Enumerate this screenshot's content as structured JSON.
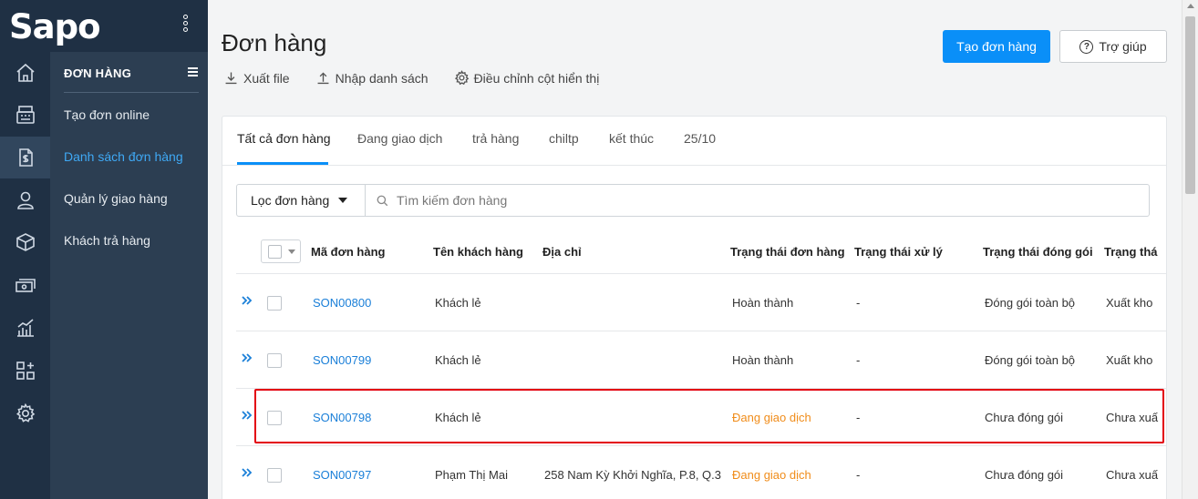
{
  "brand": {
    "logo_text": "Sapo"
  },
  "rail": {
    "items": [
      {
        "icon": "home-icon"
      },
      {
        "icon": "pos-register-icon"
      },
      {
        "icon": "order-document-icon",
        "active": true
      },
      {
        "icon": "user-icon"
      },
      {
        "icon": "box-icon"
      },
      {
        "icon": "cash-icon"
      },
      {
        "icon": "chart-icon"
      },
      {
        "icon": "apps-icon"
      },
      {
        "icon": "settings-icon"
      }
    ]
  },
  "submenu": {
    "title": "ĐƠN HÀNG",
    "items": [
      {
        "label": "Tạo đơn online"
      },
      {
        "label": "Danh sách đơn hàng",
        "active": true
      },
      {
        "label": "Quản lý giao hàng"
      },
      {
        "label": "Khách trả hàng"
      }
    ]
  },
  "header": {
    "title": "Đơn hàng",
    "create_label": "Tạo đơn hàng",
    "help_label": "Trợ giúp",
    "actions": {
      "export": "Xuất file",
      "import": "Nhập danh sách",
      "columns": "Điều chỉnh cột hiển thị"
    }
  },
  "tabs": [
    {
      "label": "Tất cả đơn hàng",
      "active": true
    },
    {
      "label": "Đang giao dịch"
    },
    {
      "label": "trả hàng"
    },
    {
      "label": "chiltp"
    },
    {
      "label": "kết thúc"
    },
    {
      "label": "25/10"
    }
  ],
  "filter": {
    "button_label": "Lọc đơn hàng",
    "search_placeholder": "Tìm kiếm đơn hàng"
  },
  "table": {
    "columns": [
      "Mã đơn hàng",
      "Tên khách hàng",
      "Địa chỉ",
      "Trạng thái đơn hàng",
      "Trạng thái xử lý",
      "Trạng thái đóng gói",
      "Trạng thá"
    ],
    "rows": [
      {
        "code": "SON00800",
        "customer": "Khách lẻ",
        "address": "",
        "order_status": "Hoàn thành",
        "process_status": "-",
        "pack_status": "Đóng gói toàn bộ",
        "ship_status": "Xuất kho"
      },
      {
        "code": "SON00799",
        "customer": "Khách lẻ",
        "address": "",
        "order_status": "Hoàn thành",
        "process_status": "-",
        "pack_status": "Đóng gói toàn bộ",
        "ship_status": "Xuất kho"
      },
      {
        "code": "SON00798",
        "customer": "Khách lẻ",
        "address": "",
        "order_status": "Đang giao dịch",
        "process_status": "-",
        "pack_status": "Chưa đóng gói",
        "ship_status": "Chưa xuấ"
      },
      {
        "code": "SON00797",
        "customer": "Phạm Thị Mai",
        "address": "258 Nam Kỳ Khởi Nghĩa, P.8, Q.3",
        "order_status": "Đang giao dịch",
        "process_status": "-",
        "pack_status": "Chưa đóng gói",
        "ship_status": "Chưa xuấ"
      }
    ]
  },
  "colors": {
    "sidebar": "#1f3044",
    "submenu": "#2c3e52",
    "primary": "#0a8ff8",
    "link": "#1a7fd8",
    "in_progress": "#f08c1a",
    "highlight": "#e3000f"
  }
}
